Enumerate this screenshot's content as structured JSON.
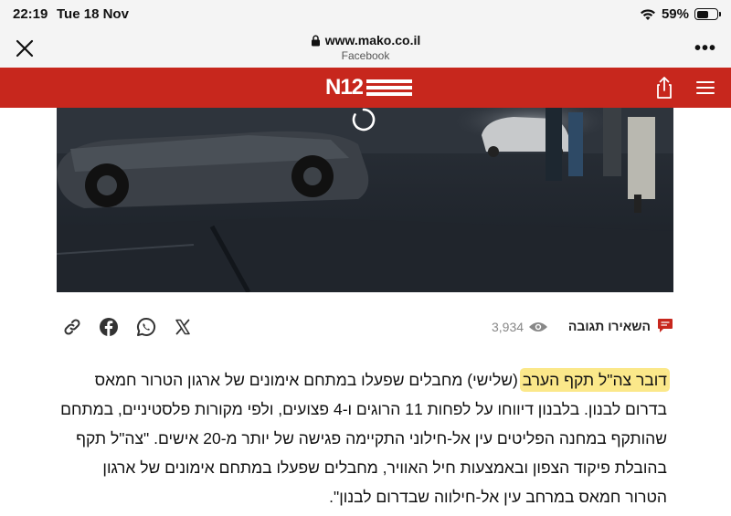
{
  "status_bar": {
    "time": "22:19",
    "date": "Tue 18 Nov",
    "battery": "59%",
    "battery_level": 0.59
  },
  "browser": {
    "url": "www.mako.co.il",
    "source": "Facebook",
    "more_label": "•••"
  },
  "site": {
    "logo_text": "N12",
    "brand_color": "#c7271d"
  },
  "article_actions": {
    "comment_label": "השאירו תגובה",
    "views": "3,934"
  },
  "article": {
    "highlight": "דובר צה\"ל תקף הערב",
    "body": " (שלישי) מחבלים שפעלו במתחם אימונים של ארגון הטרור חמאס בדרום לבנון. בלבנון דיווחו על לפחות 11 הרוגים ו-4 פצועים, ולפי מקורות פלסטיניים, במתחם שהותקף במחנה הפליטים עין אל-חילוני התקיימה פגישה של יותר מ-20 אישים. \"צה\"ל תקף בהובלת פיקוד הצפון ובאמצעות חיל האוויר, מחבלים שפעלו במתחם אימונים של ארגון הטרור חמאס במרחב עין אל-חילווה שבדרום לבנון\".",
    "highlight_color": "#fbe88a"
  },
  "icons": {
    "close": "close-icon",
    "lock": "lock-icon",
    "share": "share-icon",
    "menu": "hamburger-menu-icon",
    "comment": "comment-icon",
    "views": "eye-icon",
    "social": [
      "x-icon",
      "whatsapp-icon",
      "facebook-icon",
      "link-icon"
    ]
  }
}
